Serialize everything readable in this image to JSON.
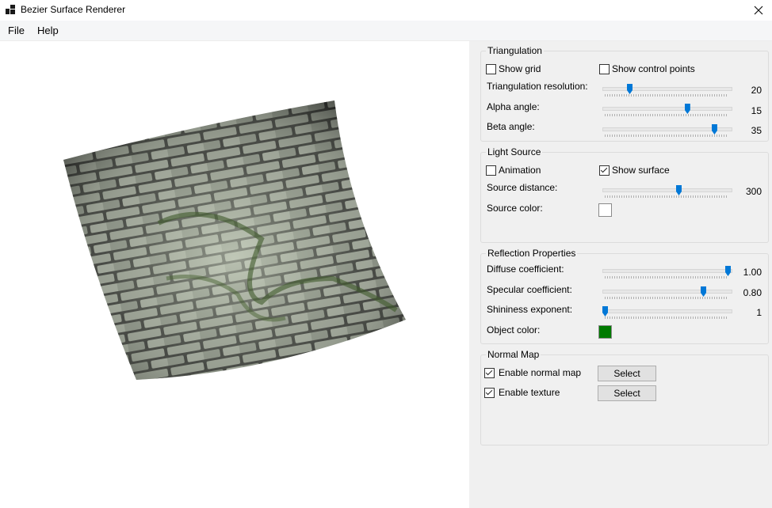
{
  "window": {
    "title": "Bezier Surface Renderer"
  },
  "menu": {
    "items": [
      "File",
      "Help"
    ]
  },
  "triangulation": {
    "title": "Triangulation",
    "show_grid": {
      "label": "Show grid",
      "checked": false
    },
    "show_control_points": {
      "label": "Show control points",
      "checked": false
    },
    "resolution": {
      "label": "Triangulation resolution:",
      "value": "20",
      "level": 0.2
    },
    "alpha": {
      "label": "Alpha angle:",
      "value": "15",
      "level": 0.67
    },
    "beta": {
      "label": "Beta angle:",
      "value": "35",
      "level": 0.89
    }
  },
  "light": {
    "title": "Light Source",
    "animation": {
      "label": "Animation",
      "checked": false
    },
    "show_surface": {
      "label": "Show surface",
      "checked": true
    },
    "distance": {
      "label": "Source distance:",
      "value": "300",
      "level": 0.6
    },
    "color": {
      "label": "Source color:",
      "hex": "#ffffff"
    }
  },
  "reflection": {
    "title": "Reflection Properties",
    "diffuse": {
      "label": "Diffuse coefficient:",
      "value": "1.00",
      "level": 1.0
    },
    "specular": {
      "label": "Specular coefficient:",
      "value": "0.80",
      "level": 0.8
    },
    "shininess": {
      "label": "Shininess exponent:",
      "value": "1",
      "level": 0.0
    },
    "object_color": {
      "label": "Object color:",
      "hex": "#007a00"
    }
  },
  "normal_map": {
    "title": "Normal Map",
    "enable_normal_map": {
      "label": "Enable normal map",
      "checked": true
    },
    "enable_texture": {
      "label": "Enable texture",
      "checked": true
    },
    "select_label": "Select"
  },
  "colors": {
    "accent": "#0078d7",
    "panel_bg": "#f0f0f0"
  },
  "icons": {
    "app": "app-grid-icon",
    "close": "close-icon"
  }
}
